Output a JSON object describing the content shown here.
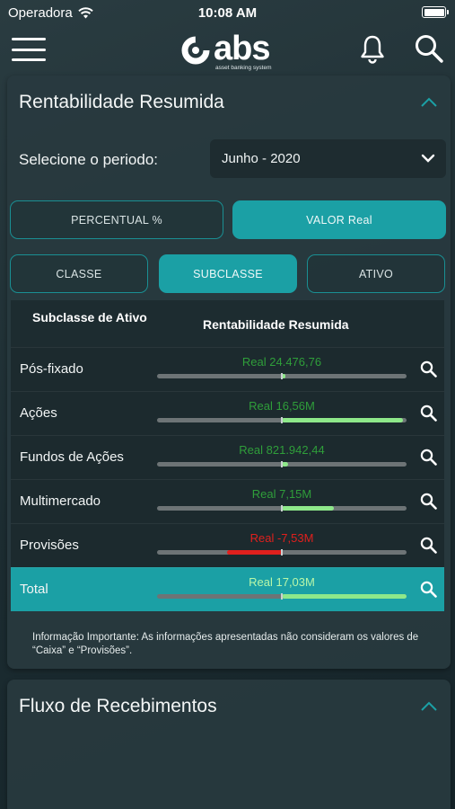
{
  "status_bar": {
    "carrier": "Operadora",
    "time": "10:08 AM"
  },
  "header": {
    "logo_text": "abs",
    "logo_tagline": "asset banking system"
  },
  "rentabilidade": {
    "title": "Rentabilidade Resumida",
    "period_label": "Selecione o periodo:",
    "period_value": "Junho - 2020",
    "mode_tabs": [
      {
        "label": "PERCENTUAL %",
        "active": false
      },
      {
        "label": "VALOR Real",
        "active": true
      }
    ],
    "group_tabs": [
      {
        "label": "CLASSE",
        "active": false
      },
      {
        "label": "SUBCLASSE",
        "active": true
      },
      {
        "label": "ATIVO",
        "active": false
      }
    ],
    "table": {
      "col1": "Subclasse de Ativo",
      "col2": "Rentabilidade Resumida",
      "rows": [
        {
          "name": "Pós-fixado",
          "value_text": "Real 24.476,76",
          "value_millions": 0.024,
          "color": "#2f9e3a"
        },
        {
          "name": "Ações",
          "value_text": "Real 16,56M",
          "value_millions": 16.56,
          "color": "#2f9e3a"
        },
        {
          "name": "Fundos de Ações",
          "value_text": "Real 821.942,44",
          "value_millions": 0.82,
          "color": "#2f9e3a"
        },
        {
          "name": "Multimercado",
          "value_text": "Real 7,15M",
          "value_millions": 7.15,
          "color": "#2f9e3a"
        },
        {
          "name": "Provisões",
          "value_text": "Real -7,53M",
          "value_millions": -7.53,
          "color": "#e0201d"
        }
      ],
      "total": {
        "name": "Total",
        "value_text": "Real 17,03M",
        "value_millions": 17.03,
        "color": "#b8f7a8"
      }
    },
    "notice": "Informação Importante: As informações apresentadas não consideram os valores de “Caixa” e “Provisões”."
  },
  "fluxo": {
    "title": "Fluxo de Recebimentos"
  },
  "colors": {
    "accent": "#1ba0a5",
    "positive_bar": "#8ee88a",
    "negative_bar": "#e0201d"
  }
}
